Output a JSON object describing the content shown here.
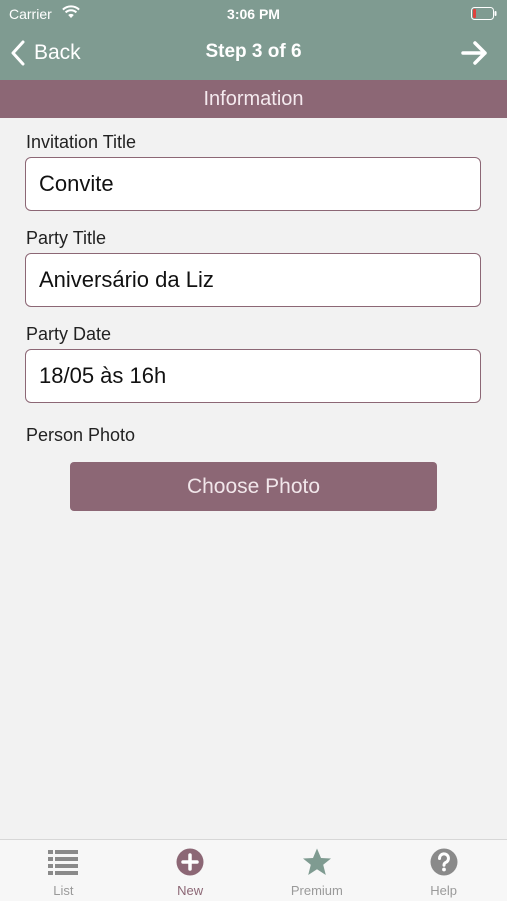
{
  "status_bar": {
    "carrier": "Carrier",
    "time": "3:06 PM"
  },
  "nav": {
    "back_label": "Back",
    "title": "Step 3 of 6"
  },
  "section": {
    "title": "Information"
  },
  "form": {
    "invitation_title_label": "Invitation Title",
    "invitation_title_value": "Convite",
    "party_title_label": "Party Title",
    "party_title_value": "Aniversário da Liz",
    "party_date_label": "Party Date",
    "party_date_value": "18/05 às 16h",
    "person_photo_label": "Person Photo",
    "choose_photo_label": "Choose Photo"
  },
  "tabs": [
    {
      "label": "List",
      "icon": "list-icon"
    },
    {
      "label": "New",
      "icon": "plus-circle-icon",
      "active": true
    },
    {
      "label": "Premium",
      "icon": "star-icon"
    },
    {
      "label": "Help",
      "icon": "question-circle-icon"
    }
  ],
  "colors": {
    "nav_bar": "#7f9b91",
    "accent": "#8c6775",
    "background": "#f2f2f2",
    "inactive_tab": "#9a9a9a"
  }
}
